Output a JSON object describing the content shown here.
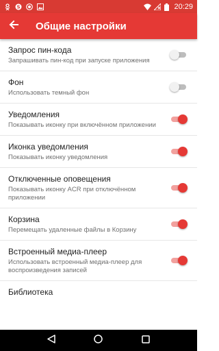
{
  "status_bar": {
    "time": "20:29",
    "left_icons": [
      "ok-icon",
      "skype-icon",
      "record-icon",
      "photo-icon"
    ],
    "right_icons": [
      "wifi-icon",
      "no-sim-icon",
      "battery-icon"
    ]
  },
  "app_bar": {
    "title": "Общие настройки",
    "color": "#e53935"
  },
  "colors": {
    "accent": "#e53935",
    "status_bar": "#d83a33"
  },
  "settings": [
    {
      "title": "Запрос пин-кода",
      "summary": "Запрашивать пин-код при запуске приложения",
      "on": false
    },
    {
      "title": "Фон",
      "summary": "Использовать темный фон",
      "on": false
    },
    {
      "title": "Уведомления",
      "summary": "Показывать иконку при включённом приложении",
      "on": true
    },
    {
      "title": "Иконка уведомления",
      "summary": "Показывать иконку уведомления",
      "on": true
    },
    {
      "title": "Отключенные оповещения",
      "summary": "Показывать иконку ACR при отключённом приложении",
      "on": true
    },
    {
      "title": "Корзина",
      "summary": "Перемещать удаленные файлы в Корзину",
      "on": true
    },
    {
      "title": "Встроенный медиа-плеер",
      "summary": "Использовать встроенный медиа-плеер для воспроизведения записей",
      "on": true
    },
    {
      "title": "Библиотека",
      "summary": "",
      "on": null
    }
  ],
  "nav_bar": {
    "buttons": [
      "back-icon",
      "home-icon",
      "recents-icon"
    ]
  }
}
